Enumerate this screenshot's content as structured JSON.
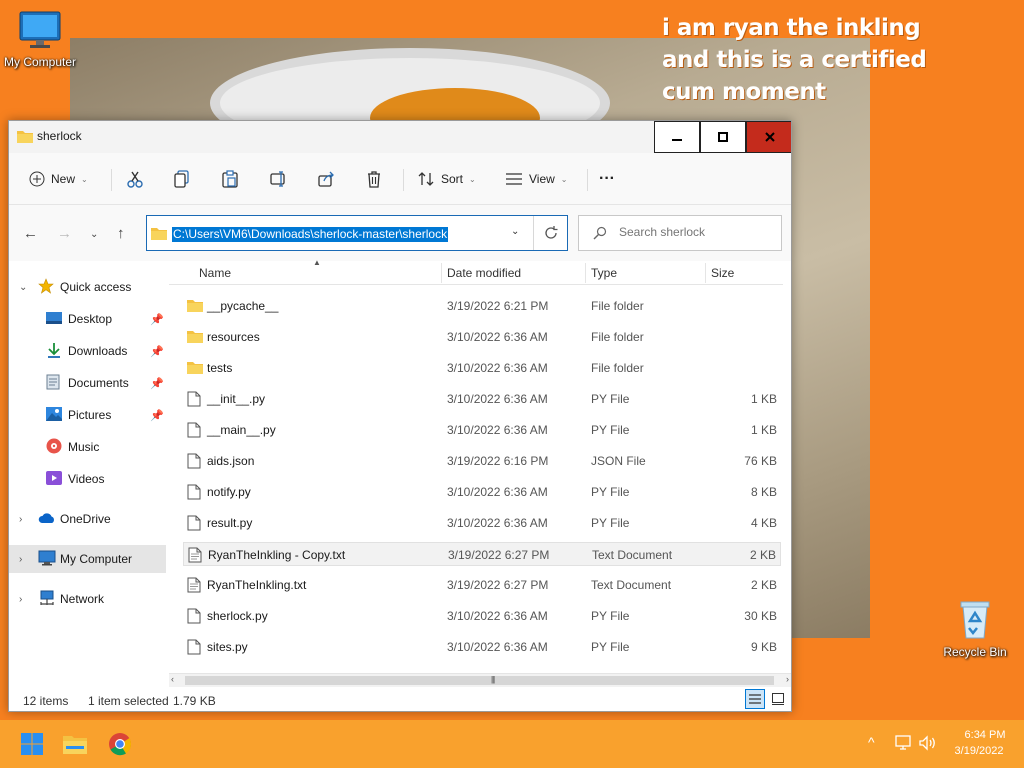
{
  "desktop": {
    "caption": "i am ryan the inkling and this is a certified cum moment",
    "icons": [
      {
        "label": "My Computer"
      },
      {
        "label": "Recycle Bin"
      }
    ]
  },
  "window": {
    "title": "sherlock",
    "controls": {
      "minimize": "–",
      "maximize": "☐",
      "close": "✕"
    }
  },
  "command_bar": {
    "new_label": "New",
    "sort_label": "Sort",
    "view_label": "View",
    "more_label": "···"
  },
  "address": {
    "path": "C:\\Users\\VM6\\Downloads\\sherlock-master\\sherlock"
  },
  "search": {
    "placeholder": "Search sherlock"
  },
  "sidebar": {
    "quick_access": "Quick access",
    "items": [
      {
        "label": "Desktop",
        "pinned": true
      },
      {
        "label": "Downloads",
        "pinned": true
      },
      {
        "label": "Documents",
        "pinned": true
      },
      {
        "label": "Pictures",
        "pinned": true
      },
      {
        "label": "Music",
        "pinned": false
      },
      {
        "label": "Videos",
        "pinned": false
      }
    ],
    "onedrive": "OneDrive",
    "my_computer": "My Computer",
    "network": "Network"
  },
  "columns": {
    "name": "Name",
    "date": "Date modified",
    "type": "Type",
    "size": "Size"
  },
  "files": [
    {
      "name": "__pycache__",
      "date": "3/19/2022 6:21 PM",
      "type": "File folder",
      "size": "",
      "kind": "folder"
    },
    {
      "name": "resources",
      "date": "3/10/2022 6:36 AM",
      "type": "File folder",
      "size": "",
      "kind": "folder"
    },
    {
      "name": "tests",
      "date": "3/10/2022 6:36 AM",
      "type": "File folder",
      "size": "",
      "kind": "folder"
    },
    {
      "name": "__init__.py",
      "date": "3/10/2022 6:36 AM",
      "type": "PY File",
      "size": "1 KB",
      "kind": "file"
    },
    {
      "name": "__main__.py",
      "date": "3/10/2022 6:36 AM",
      "type": "PY File",
      "size": "1 KB",
      "kind": "file"
    },
    {
      "name": "aids.json",
      "date": "3/19/2022 6:16 PM",
      "type": "JSON File",
      "size": "76 KB",
      "kind": "file"
    },
    {
      "name": "notify.py",
      "date": "3/10/2022 6:36 AM",
      "type": "PY File",
      "size": "8 KB",
      "kind": "file"
    },
    {
      "name": "result.py",
      "date": "3/10/2022 6:36 AM",
      "type": "PY File",
      "size": "4 KB",
      "kind": "file"
    },
    {
      "name": "RyanTheInkling - Copy.txt",
      "date": "3/19/2022 6:27 PM",
      "type": "Text Document",
      "size": "2 KB",
      "kind": "text",
      "selected": true
    },
    {
      "name": "RyanTheInkling.txt",
      "date": "3/19/2022 6:27 PM",
      "type": "Text Document",
      "size": "2 KB",
      "kind": "text"
    },
    {
      "name": "sherlock.py",
      "date": "3/10/2022 6:36 AM",
      "type": "PY File",
      "size": "30 KB",
      "kind": "file"
    },
    {
      "name": "sites.py",
      "date": "3/10/2022 6:36 AM",
      "type": "PY File",
      "size": "9 KB",
      "kind": "file"
    }
  ],
  "status": {
    "count": "12 items",
    "selected": "1 item selected",
    "size": "1.79 KB"
  },
  "taskbar": {
    "time": "6:34 PM",
    "date": "3/19/2022"
  },
  "colors": {
    "desktop_bg": "#f7801f",
    "taskbar_bg": "#f9a12d",
    "accent": "#0078d4",
    "folder": "#f4c242",
    "close": "#c42b1c"
  }
}
